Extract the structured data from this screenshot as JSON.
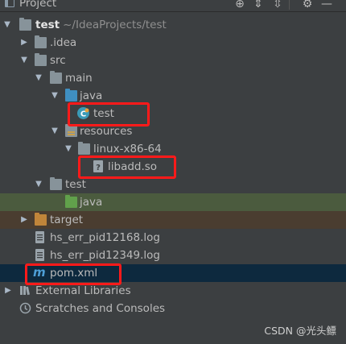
{
  "panel": {
    "title": "Project"
  },
  "tree": [
    {
      "label": "test",
      "hint": "~/IdeaProjects/test"
    },
    {
      "label": ".idea"
    },
    {
      "label": "src"
    },
    {
      "label": "main"
    },
    {
      "label": "java"
    },
    {
      "label": "test"
    },
    {
      "label": "resources"
    },
    {
      "label": "linux-x86-64"
    },
    {
      "label": "libadd.so"
    },
    {
      "label": "test"
    },
    {
      "label": "java"
    },
    {
      "label": "target"
    },
    {
      "label": "hs_err_pid12168.log"
    },
    {
      "label": "hs_err_pid12349.log"
    },
    {
      "label": "pom.xml"
    },
    {
      "label": "External Libraries"
    },
    {
      "label": "Scratches and Consoles"
    }
  ],
  "watermark": "CSDN @光头鳔"
}
